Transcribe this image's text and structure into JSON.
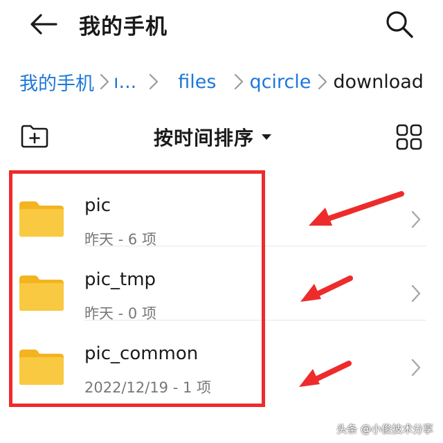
{
  "header": {
    "title": "我的手机"
  },
  "breadcrumb": {
    "items": [
      "我的手机",
      "ı...",
      "files",
      "qcircle",
      "download"
    ]
  },
  "toolbar": {
    "sort_label": "按时间排序"
  },
  "files": [
    {
      "name": "pic",
      "date": "昨天",
      "count": "6 项",
      "meta": "昨天 - 6 项"
    },
    {
      "name": "pic_tmp",
      "date": "昨天",
      "count": "0 项",
      "meta": "昨天 - 0 项"
    },
    {
      "name": "pic_common",
      "date": "2022/12/19",
      "count": "1 项",
      "meta": "2022/12/19 - 1 项"
    }
  ],
  "colors": {
    "accent": "#1d77d8",
    "folder": "#f9c941",
    "folder_tab": "#f3b420",
    "annotation": "#ee2b2b"
  },
  "watermark": "头条 @小俊技术分享"
}
